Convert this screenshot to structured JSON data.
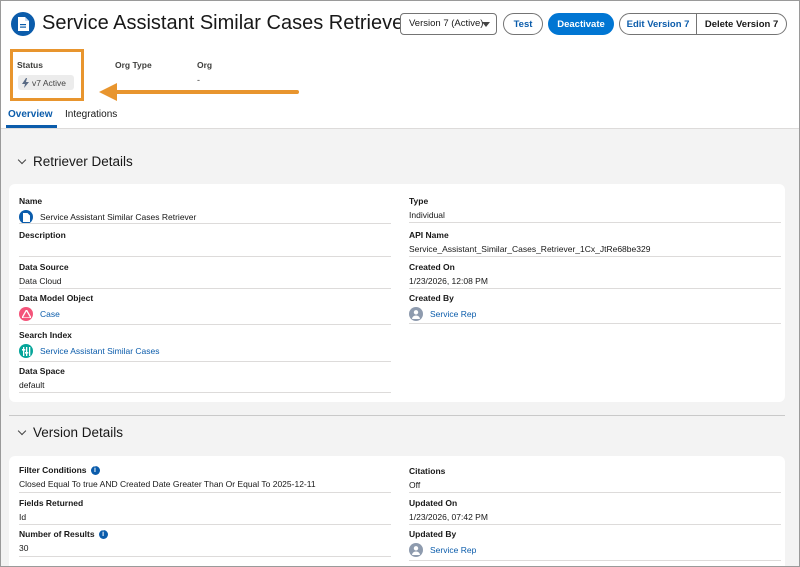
{
  "header": {
    "title": "Service Assistant Similar Cases Retriever",
    "version_select": "Version 7 (Active)",
    "buttons": {
      "test": "Test",
      "deactivate": "Deactivate",
      "edit": "Edit Version 7",
      "delete": "Delete Version 7"
    },
    "fields": {
      "status_label": "Status",
      "status_value": "v7 Active",
      "org_type_label": "Org Type",
      "org_type_value": "",
      "org_label": "Org",
      "org_value": "-"
    }
  },
  "tabs": [
    {
      "label": "Overview",
      "active": true
    },
    {
      "label": "Integrations",
      "active": false
    }
  ],
  "retriever_details": {
    "title": "Retriever Details",
    "left": {
      "name_label": "Name",
      "name_value": "Service Assistant Similar Cases Retriever",
      "description_label": "Description",
      "description_value": "",
      "data_source_label": "Data Source",
      "data_source_value": "Data Cloud",
      "dmo_label": "Data Model Object",
      "dmo_value": "Case",
      "search_index_label": "Search Index",
      "search_index_value": "Service Assistant Similar Cases",
      "data_space_label": "Data Space",
      "data_space_value": "default"
    },
    "right": {
      "type_label": "Type",
      "type_value": "Individual",
      "api_name_label": "API Name",
      "api_name_value": "Service_Assistant_Similar_Cases_Retriever_1Cx_JtRe68be329",
      "created_on_label": "Created On",
      "created_on_value": "1/23/2026, 12:08 PM",
      "created_by_label": "Created By",
      "created_by_value": "Service Rep"
    }
  },
  "version_details": {
    "title": "Version Details",
    "left": {
      "filter_label": "Filter Conditions",
      "filter_value": "Closed Equal To true AND Created Date Greater Than Or Equal To 2025-12-11",
      "fields_returned_label": "Fields Returned",
      "fields_returned_value": "Id",
      "num_results_label": "Number of Results",
      "num_results_value": "30"
    },
    "right": {
      "citations_label": "Citations",
      "citations_value": "Off",
      "updated_on_label": "Updated On",
      "updated_on_value": "1/23/2026, 07:42 PM",
      "updated_by_label": "Updated By",
      "updated_by_value": "Service Rep"
    }
  },
  "colors": {
    "brand": "#0176d3",
    "link": "#0b5cab",
    "highlight": "#e8952e",
    "case_icon": "#f4547a",
    "search_index_icon": "#06a59a",
    "avatar": "#8e9bae"
  },
  "icons": {
    "title": "document-icon",
    "status": "bolt-icon",
    "dmo": "case-icon",
    "search_index": "search-index-icon",
    "user": "user-avatar-icon",
    "info": "info-icon"
  }
}
